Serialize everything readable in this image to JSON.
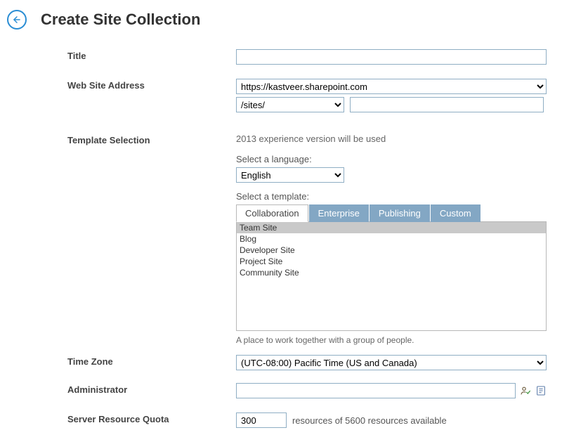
{
  "header": {
    "title": "Create Site Collection"
  },
  "labels": {
    "title": "Title",
    "address": "Web Site Address",
    "template": "Template Selection",
    "timezone": "Time Zone",
    "admin": "Administrator",
    "quota": "Server Resource Quota"
  },
  "title_value": "",
  "address": {
    "domain_selected": "https://kastveer.sharepoint.com",
    "path_selected": "/sites/",
    "suffix_value": ""
  },
  "template": {
    "experience_hint": "2013 experience version will be used",
    "language_label": "Select a language:",
    "language_selected": "English",
    "template_label": "Select a template:",
    "tabs": [
      "Collaboration",
      "Enterprise",
      "Publishing",
      "Custom"
    ],
    "active_tab": "Collaboration",
    "list": [
      "Team Site",
      "Blog",
      "Developer Site",
      "Project Site",
      "Community Site"
    ],
    "selected": "Team Site",
    "description": "A place to work together with a group of people."
  },
  "timezone": {
    "selected": "(UTC-08:00) Pacific Time (US and Canada)"
  },
  "admin_value": "",
  "quota": {
    "value": "300",
    "text": "resources of 5600 resources available"
  }
}
